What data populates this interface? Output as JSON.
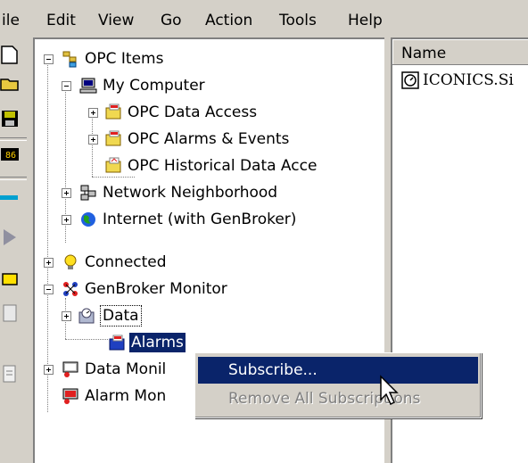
{
  "menubar": {
    "items": [
      "ile",
      "Edit",
      "View",
      "Go",
      "Action",
      "Tools",
      "Help"
    ]
  },
  "tree": {
    "opc_items": "OPC Items",
    "my_computer": "My Computer",
    "opc_data_access": "OPC Data Access",
    "opc_alarms_events": "OPC Alarms & Events",
    "opc_historical": "OPC Historical Data Acce",
    "network_neighborhood": "Network Neighborhood",
    "internet": "Internet (with GenBroker)",
    "connected": "Connected",
    "genbroker_monitor": "GenBroker Monitor",
    "data": "Data",
    "alarms": "Alarms",
    "data_monitor": "Data Monil",
    "alarm_monitor": "Alarm Mon"
  },
  "list": {
    "column_name": "Name",
    "items": [
      "ICONICS.Si"
    ]
  },
  "context_menu": {
    "subscribe": "Subscribe...",
    "remove_all": "Remove All Subscriptions"
  },
  "colors": {
    "selection": "#0a246a",
    "face": "#d4d0c8"
  }
}
